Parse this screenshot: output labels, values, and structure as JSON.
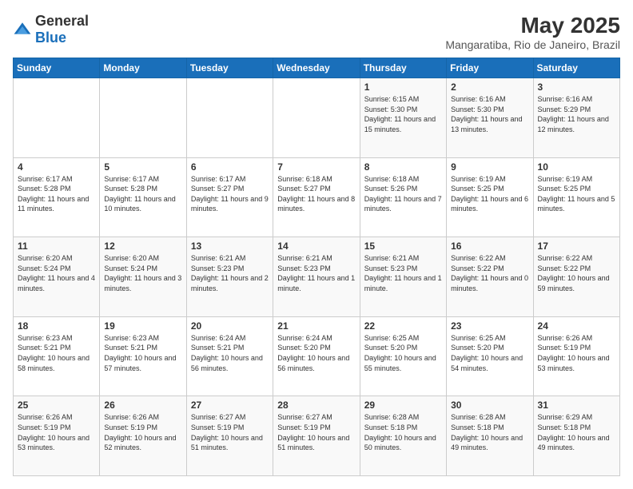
{
  "header": {
    "logo_general": "General",
    "logo_blue": "Blue",
    "title": "May 2025",
    "location": "Mangaratiba, Rio de Janeiro, Brazil"
  },
  "weekdays": [
    "Sunday",
    "Monday",
    "Tuesday",
    "Wednesday",
    "Thursday",
    "Friday",
    "Saturday"
  ],
  "weeks": [
    [
      {
        "day": "",
        "info": ""
      },
      {
        "day": "",
        "info": ""
      },
      {
        "day": "",
        "info": ""
      },
      {
        "day": "",
        "info": ""
      },
      {
        "day": "1",
        "info": "Sunrise: 6:15 AM\nSunset: 5:30 PM\nDaylight: 11 hours and 15 minutes."
      },
      {
        "day": "2",
        "info": "Sunrise: 6:16 AM\nSunset: 5:30 PM\nDaylight: 11 hours and 13 minutes."
      },
      {
        "day": "3",
        "info": "Sunrise: 6:16 AM\nSunset: 5:29 PM\nDaylight: 11 hours and 12 minutes."
      }
    ],
    [
      {
        "day": "4",
        "info": "Sunrise: 6:17 AM\nSunset: 5:28 PM\nDaylight: 11 hours and 11 minutes."
      },
      {
        "day": "5",
        "info": "Sunrise: 6:17 AM\nSunset: 5:28 PM\nDaylight: 11 hours and 10 minutes."
      },
      {
        "day": "6",
        "info": "Sunrise: 6:17 AM\nSunset: 5:27 PM\nDaylight: 11 hours and 9 minutes."
      },
      {
        "day": "7",
        "info": "Sunrise: 6:18 AM\nSunset: 5:27 PM\nDaylight: 11 hours and 8 minutes."
      },
      {
        "day": "8",
        "info": "Sunrise: 6:18 AM\nSunset: 5:26 PM\nDaylight: 11 hours and 7 minutes."
      },
      {
        "day": "9",
        "info": "Sunrise: 6:19 AM\nSunset: 5:25 PM\nDaylight: 11 hours and 6 minutes."
      },
      {
        "day": "10",
        "info": "Sunrise: 6:19 AM\nSunset: 5:25 PM\nDaylight: 11 hours and 5 minutes."
      }
    ],
    [
      {
        "day": "11",
        "info": "Sunrise: 6:20 AM\nSunset: 5:24 PM\nDaylight: 11 hours and 4 minutes."
      },
      {
        "day": "12",
        "info": "Sunrise: 6:20 AM\nSunset: 5:24 PM\nDaylight: 11 hours and 3 minutes."
      },
      {
        "day": "13",
        "info": "Sunrise: 6:21 AM\nSunset: 5:23 PM\nDaylight: 11 hours and 2 minutes."
      },
      {
        "day": "14",
        "info": "Sunrise: 6:21 AM\nSunset: 5:23 PM\nDaylight: 11 hours and 1 minute."
      },
      {
        "day": "15",
        "info": "Sunrise: 6:21 AM\nSunset: 5:23 PM\nDaylight: 11 hours and 1 minute."
      },
      {
        "day": "16",
        "info": "Sunrise: 6:22 AM\nSunset: 5:22 PM\nDaylight: 11 hours and 0 minutes."
      },
      {
        "day": "17",
        "info": "Sunrise: 6:22 AM\nSunset: 5:22 PM\nDaylight: 10 hours and 59 minutes."
      }
    ],
    [
      {
        "day": "18",
        "info": "Sunrise: 6:23 AM\nSunset: 5:21 PM\nDaylight: 10 hours and 58 minutes."
      },
      {
        "day": "19",
        "info": "Sunrise: 6:23 AM\nSunset: 5:21 PM\nDaylight: 10 hours and 57 minutes."
      },
      {
        "day": "20",
        "info": "Sunrise: 6:24 AM\nSunset: 5:21 PM\nDaylight: 10 hours and 56 minutes."
      },
      {
        "day": "21",
        "info": "Sunrise: 6:24 AM\nSunset: 5:20 PM\nDaylight: 10 hours and 56 minutes."
      },
      {
        "day": "22",
        "info": "Sunrise: 6:25 AM\nSunset: 5:20 PM\nDaylight: 10 hours and 55 minutes."
      },
      {
        "day": "23",
        "info": "Sunrise: 6:25 AM\nSunset: 5:20 PM\nDaylight: 10 hours and 54 minutes."
      },
      {
        "day": "24",
        "info": "Sunrise: 6:26 AM\nSunset: 5:19 PM\nDaylight: 10 hours and 53 minutes."
      }
    ],
    [
      {
        "day": "25",
        "info": "Sunrise: 6:26 AM\nSunset: 5:19 PM\nDaylight: 10 hours and 53 minutes."
      },
      {
        "day": "26",
        "info": "Sunrise: 6:26 AM\nSunset: 5:19 PM\nDaylight: 10 hours and 52 minutes."
      },
      {
        "day": "27",
        "info": "Sunrise: 6:27 AM\nSunset: 5:19 PM\nDaylight: 10 hours and 51 minutes."
      },
      {
        "day": "28",
        "info": "Sunrise: 6:27 AM\nSunset: 5:19 PM\nDaylight: 10 hours and 51 minutes."
      },
      {
        "day": "29",
        "info": "Sunrise: 6:28 AM\nSunset: 5:18 PM\nDaylight: 10 hours and 50 minutes."
      },
      {
        "day": "30",
        "info": "Sunrise: 6:28 AM\nSunset: 5:18 PM\nDaylight: 10 hours and 49 minutes."
      },
      {
        "day": "31",
        "info": "Sunrise: 6:29 AM\nSunset: 5:18 PM\nDaylight: 10 hours and 49 minutes."
      }
    ]
  ]
}
